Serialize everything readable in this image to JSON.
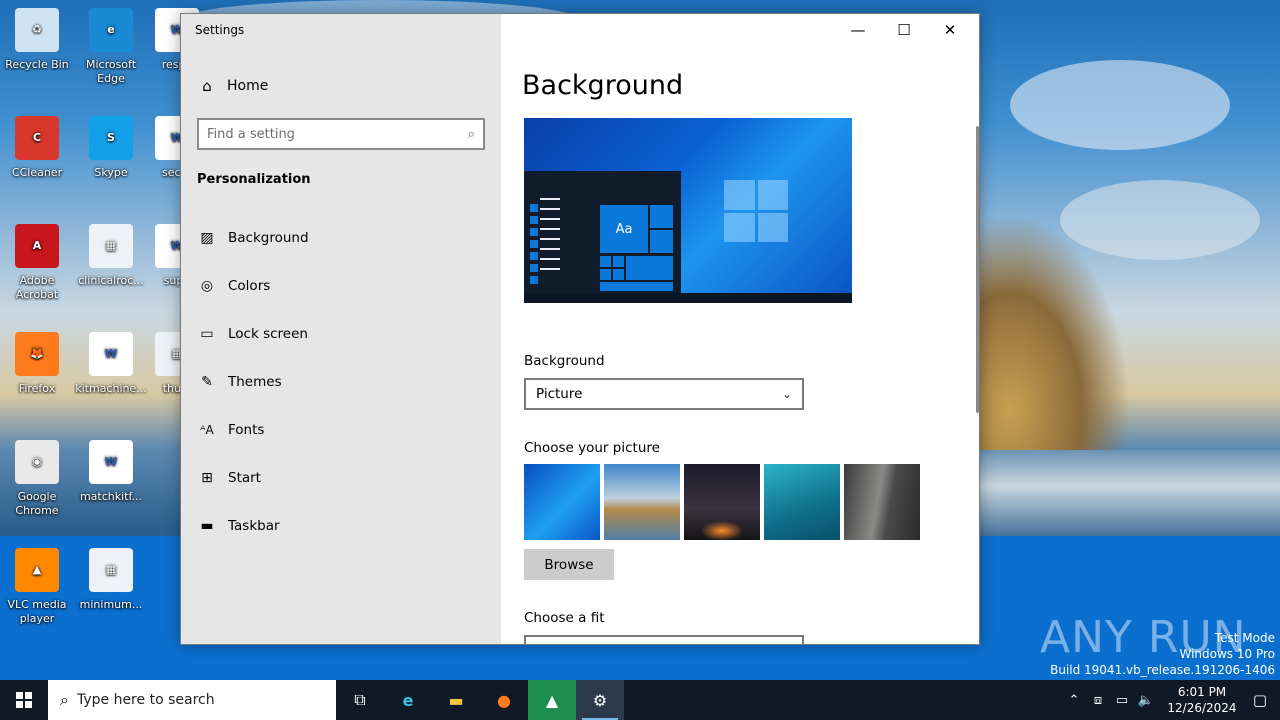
{
  "desktop": {
    "icons": [
      {
        "label": "Recycle Bin",
        "glyph": "♻",
        "color": "#cfe3f2"
      },
      {
        "label": "Microsoft Edge",
        "glyph": "e",
        "color": "#1a8ad4"
      },
      {
        "label": "respe",
        "glyph": "W",
        "color": "#ffffff"
      },
      {
        "label": "CCleaner",
        "glyph": "C",
        "color": "#d8382c"
      },
      {
        "label": "Skype",
        "glyph": "S",
        "color": "#12a0e8"
      },
      {
        "label": "secur",
        "glyph": "W",
        "color": "#ffffff"
      },
      {
        "label": "Adobe Acrobat",
        "glyph": "A",
        "color": "#c8161d"
      },
      {
        "label": "clinicalroc...",
        "glyph": "▦",
        "color": "#eef2f6"
      },
      {
        "label": "supp",
        "glyph": "W",
        "color": "#ffffff"
      },
      {
        "label": "Firefox",
        "glyph": "🦊",
        "color": "#ff7a1a"
      },
      {
        "label": "kitmachine...",
        "glyph": "W",
        "color": "#ffffff"
      },
      {
        "label": "thurs",
        "glyph": "▦",
        "color": "#eef2f6"
      },
      {
        "label": "Google Chrome",
        "glyph": "◉",
        "color": "#e9e9e9"
      },
      {
        "label": "matchkitf...",
        "glyph": "W",
        "color": "#ffffff"
      },
      {
        "label": "VLC media player",
        "glyph": "▲",
        "color": "#ff8800"
      },
      {
        "label": "minimum...",
        "glyph": "▦",
        "color": "#eef2f6"
      }
    ]
  },
  "settings": {
    "window_title": "Settings",
    "home_label": "Home",
    "search_placeholder": "Find a setting",
    "section_title": "Personalization",
    "nav_items": [
      {
        "label": "Background",
        "icon": "picture-icon"
      },
      {
        "label": "Colors",
        "icon": "palette-icon"
      },
      {
        "label": "Lock screen",
        "icon": "lock-screen-icon"
      },
      {
        "label": "Themes",
        "icon": "themes-icon"
      },
      {
        "label": "Fonts",
        "icon": "fonts-icon"
      },
      {
        "label": "Start",
        "icon": "start-icon"
      },
      {
        "label": "Taskbar",
        "icon": "taskbar-icon"
      }
    ],
    "page_title": "Background",
    "preview_sample_text": "Aa",
    "background_label": "Background",
    "background_value": "Picture",
    "choose_picture_label": "Choose your picture",
    "browse_label": "Browse",
    "choose_fit_label": "Choose a fit"
  },
  "watermark": {
    "brand": "ANY RUN",
    "mode": "Test Mode",
    "edition": "Windows 10 Pro",
    "build": "Build 19041.vb_release.191206-1406"
  },
  "taskbar": {
    "search_placeholder": "Type here to search",
    "time": "6:01 PM",
    "date": "12/26/2024"
  }
}
